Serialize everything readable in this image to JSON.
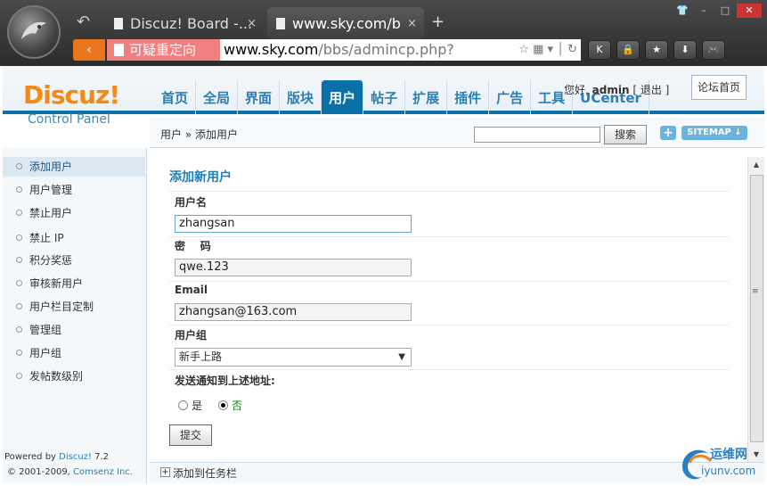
{
  "browser": {
    "tabs": [
      {
        "label": "Discuz! Board -...",
        "close": "×"
      },
      {
        "label": "www.sky.com/b",
        "close": "×"
      }
    ],
    "new_tab": "+",
    "back_glyph": "↶",
    "redirect_label": "可疑重定向",
    "url_host": "www.sky.com",
    "url_path": "/bbs/admincp.php?",
    "toolbar_buttons": [
      "K",
      "🔒",
      "★",
      "⬇",
      "🎮"
    ],
    "window_buttons": [
      "👕",
      "–",
      "□",
      "✕"
    ]
  },
  "header": {
    "logo": "Discuz!",
    "subtitle": "Control Panel",
    "nav": [
      "首页",
      "全局",
      "界面",
      "版块",
      "用户",
      "帖子",
      "扩展",
      "插件",
      "广告",
      "工具",
      "UCenter"
    ],
    "active_nav": "用户",
    "greeting": "您好,",
    "username": "admin",
    "logout": "[ 退出 ]",
    "forum_home": "论坛首页"
  },
  "breadcrumb": {
    "text": "用户 » 添加用户",
    "search_button": "搜索",
    "plus": "+",
    "sitemap": "SITEMAP ↓"
  },
  "sidebar": {
    "items": [
      {
        "label": "添加用户",
        "active": true
      },
      {
        "label": "用户管理",
        "active": false
      },
      {
        "label": "禁止用户",
        "active": false
      },
      {
        "label": "禁止 IP",
        "active": false
      },
      {
        "label": "积分奖惩",
        "active": false
      },
      {
        "label": "审核新用户",
        "active": false
      },
      {
        "label": "用户栏目定制",
        "active": false
      },
      {
        "label": "管理组",
        "active": false
      },
      {
        "label": "用户组",
        "active": false
      },
      {
        "label": "发帖数级别",
        "active": false
      }
    ],
    "powered_prefix": "Powered by ",
    "powered_link": "Discuz!",
    "powered_version": " 7.2",
    "copyright_prefix": "© 2001-2009, ",
    "copyright_link": "Comsenz Inc."
  },
  "form": {
    "title": "添加新用户",
    "username_label": "用户名",
    "username_value": "zhangsan",
    "password_label": "密    码",
    "password_value": "qwe.123",
    "email_label": "Email",
    "email_value": "zhangsan@163.com",
    "usergroup_label": "用户组",
    "usergroup_value": "新手上路",
    "notify_label": "发送通知到上述地址:",
    "notify_yes": "是",
    "notify_no": "否",
    "notify_selected": "否",
    "submit": "提交"
  },
  "taskbar": {
    "plus": "+",
    "label": "添加到任务栏"
  },
  "watermark": {
    "line1": "运维网",
    "line2": "iyunv.com"
  }
}
